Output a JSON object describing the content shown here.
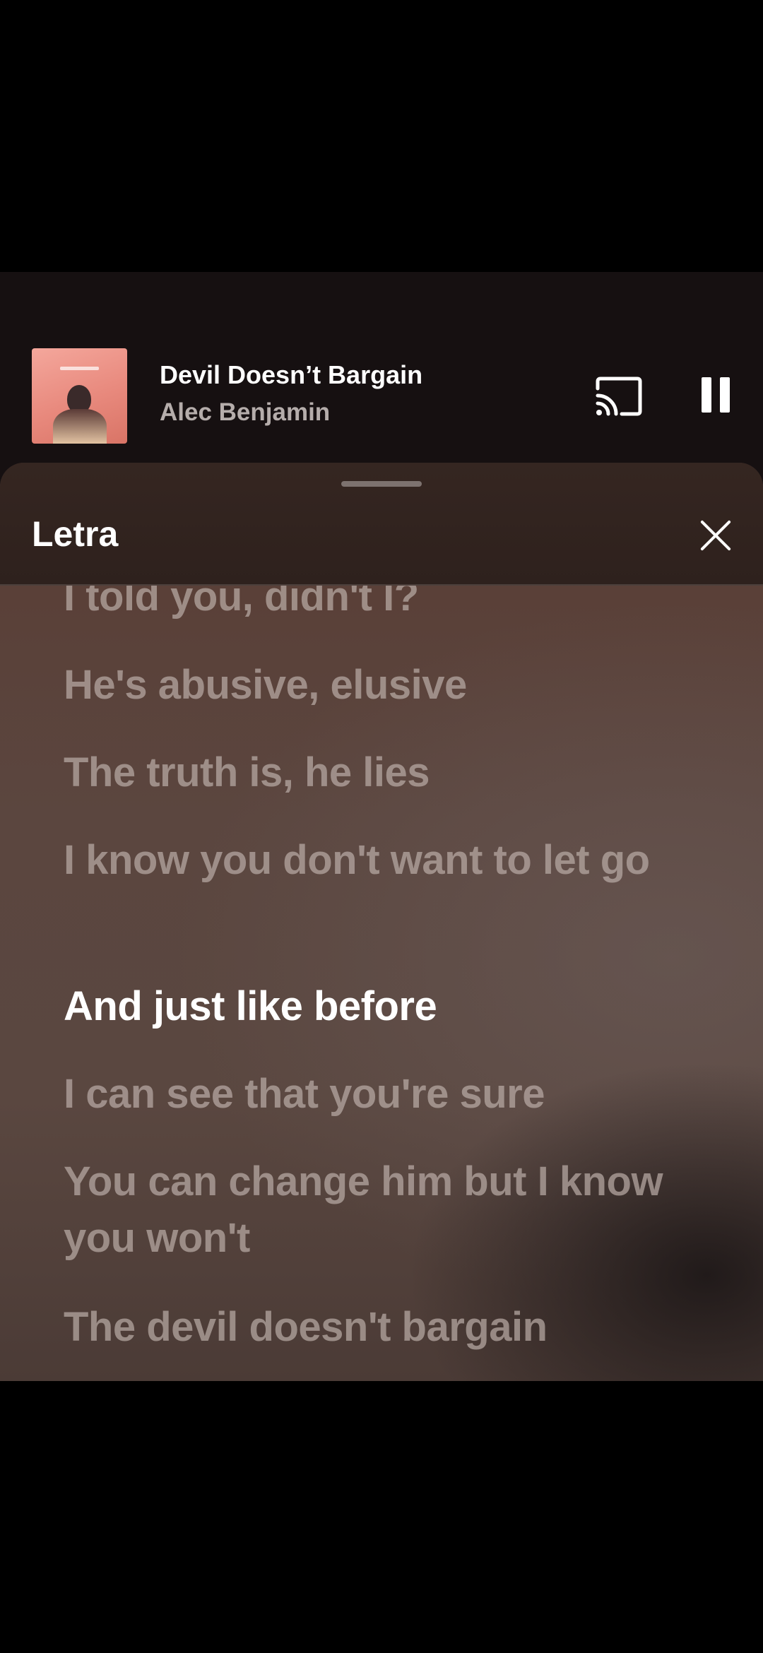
{
  "mini_player": {
    "title": "Devil Doesn’t Bargain",
    "artist": "Alec Benjamin",
    "cast_icon": "cast-icon",
    "pause_icon": "pause-icon"
  },
  "lyrics_sheet": {
    "title": "Letra",
    "close_icon": "close-icon",
    "lines": [
      "I told you, didn't I?",
      "He's abusive, elusive",
      "The truth is, he lies",
      "I know you don't want to let go",
      "And just like before",
      "I can see that you're sure",
      "You can change him but I know you won't",
      "The devil doesn't bargain"
    ],
    "active_line_index": 4
  },
  "colors": {
    "background": "#000000",
    "player_bg": "#161011",
    "sheet_header_bg": "#2e211d",
    "lyric_inactive": "#b9aaa5",
    "lyric_active": "#ffffff"
  }
}
